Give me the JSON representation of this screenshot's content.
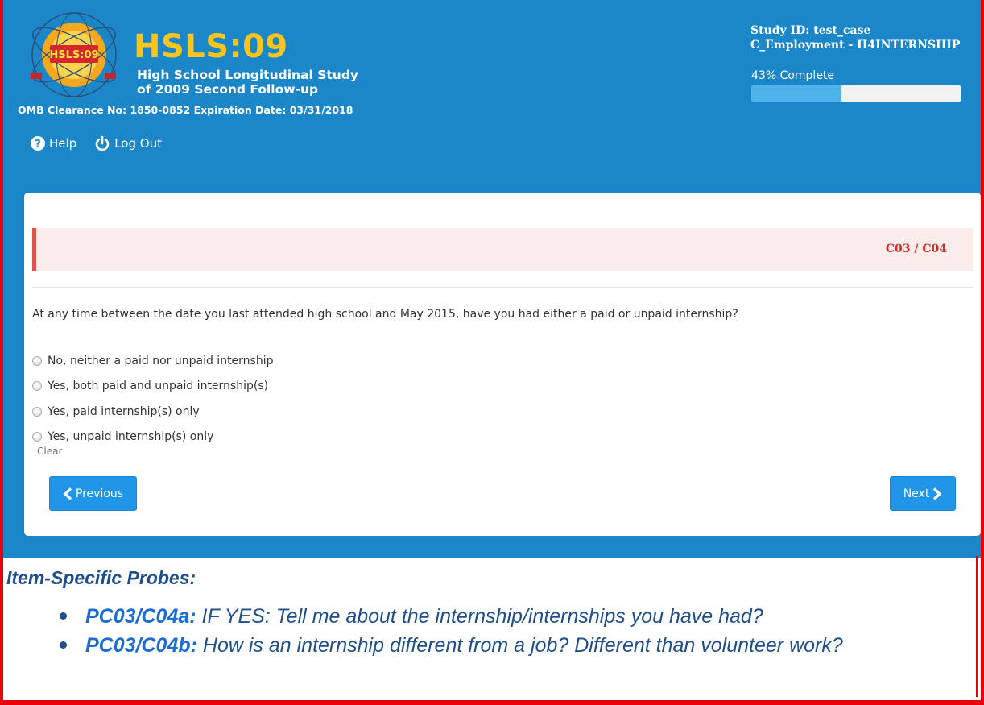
{
  "header": {
    "logo_badge": "HSLS:09",
    "brand_title": "HSLS:09",
    "brand_sub1": "High School Longitudinal Study",
    "brand_sub2": "of 2009 Second Follow-up",
    "omb": "OMB Clearance No: 1850-0852 Expiration Date: 03/31/2018",
    "help_label": "Help",
    "logout_label": "Log Out",
    "study_id": "Study ID: test_case",
    "section": "C_Employment - H4INTERNSHIP",
    "progress_text": "43% Complete",
    "progress_value": 0.43
  },
  "question": {
    "code": "C03 / C04",
    "text": "At any time between the date you last attended high school and May 2015, have you had either a paid or unpaid internship?",
    "options": [
      "No, neither a paid nor unpaid internship",
      "Yes, both paid and unpaid internship(s)",
      "Yes, paid internship(s) only",
      "Yes, unpaid internship(s) only"
    ],
    "clear_label": "Clear"
  },
  "nav": {
    "previous_label": "Previous",
    "next_label": "Next"
  },
  "probes": {
    "title": "Item-Specific Probes:",
    "items": [
      {
        "code": "PC03/C04a:",
        "text": "IF YES: Tell me about the internship/internships you have had?"
      },
      {
        "code": "PC03/C04b:",
        "text": "How is an internship different from a job? Different than volunteer work?"
      }
    ]
  },
  "colors": {
    "app_blue": "#1c87c8",
    "brand_yellow": "#f7c51e",
    "button_blue": "#2196e8",
    "alert_red": "#d9534f",
    "frame_red": "#e8000b",
    "probe_navy": "#1f4e8c"
  }
}
